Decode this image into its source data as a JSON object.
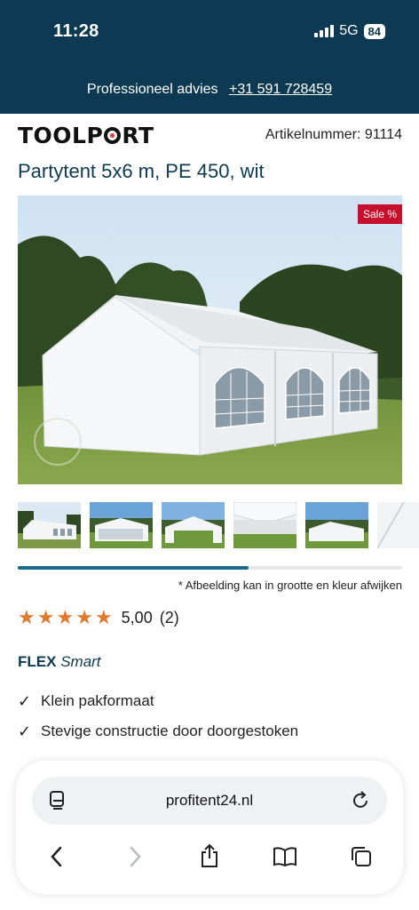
{
  "status": {
    "time": "11:28",
    "network": "5G",
    "battery": "84"
  },
  "promo": {
    "text": "Professioneel advies",
    "phone": "+31 591 728459"
  },
  "brand": {
    "logo_left": "TOOLP",
    "logo_right": "RT",
    "article_number": "Artikelnummer: 91114"
  },
  "product": {
    "title": "Partytent 5x6 m, PE 450, wit",
    "sale_badge": "Sale %",
    "image_note": "* Afbeelding kan in grootte en kleur afwijken",
    "rating": {
      "stars": 5,
      "score": "5,00",
      "count": "(2)"
    },
    "line_brand": "FLEX",
    "line_sub": "Smart",
    "features": [
      "Klein pakformaat",
      "Stevige constructie door doorgestoken"
    ],
    "gallery_progress": 0.6
  },
  "browser": {
    "url": "profitent24.nl"
  },
  "icons": {
    "reader": "reader-icon",
    "reload": "reload-icon",
    "back": "back-icon",
    "forward": "forward-icon",
    "share": "share-icon",
    "bookmarks": "bookmarks-icon",
    "tabs": "tabs-icon"
  },
  "colors": {
    "header_bg": "#0d3a52",
    "sale": "#c8102e",
    "star": "#e07a2f",
    "accent": "#1a6a8e"
  }
}
